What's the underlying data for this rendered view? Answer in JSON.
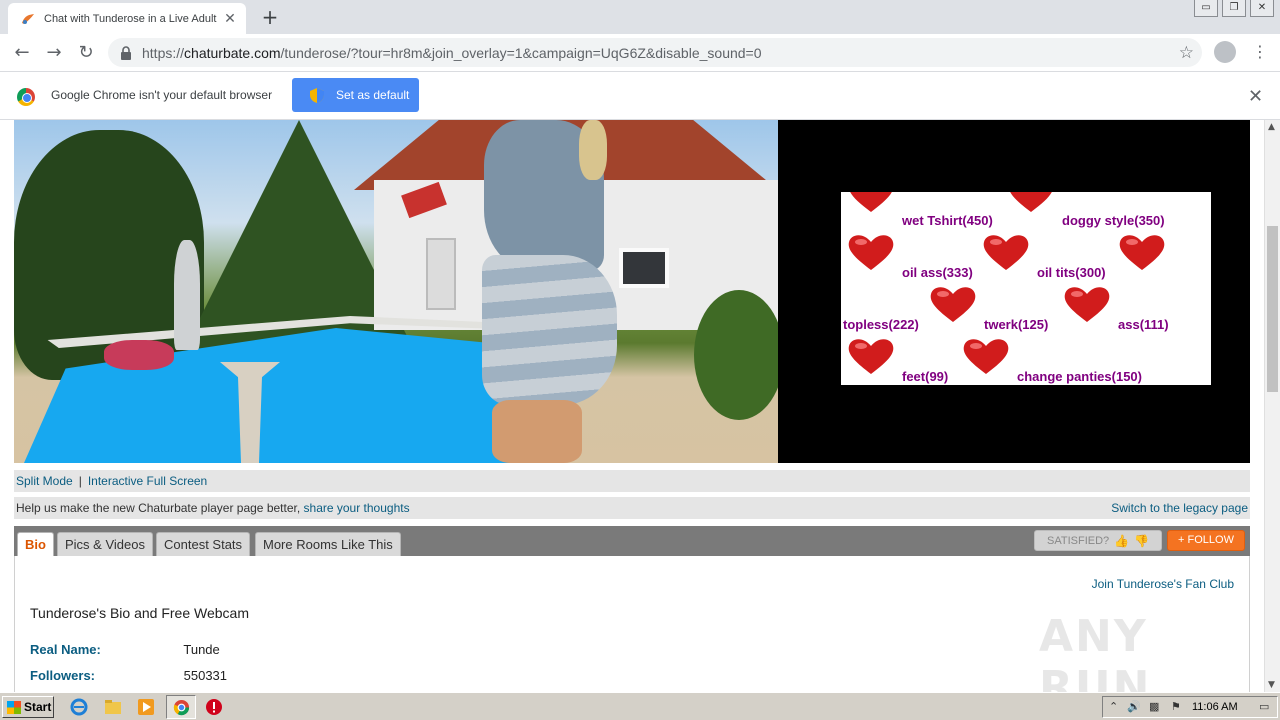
{
  "browser": {
    "tab_title": "Chat with Tunderose in a Live Adult",
    "tab_close": "✕",
    "new_tab": "+",
    "url_scheme": "https://",
    "url_host": "chaturbate.com",
    "url_path": "/tunderose/?tour=hr8m&join_overlay=1&campaign=UqG6Z&disable_sound=0",
    "window_controls": [
      "▭",
      "❐",
      "✕"
    ]
  },
  "infobar": {
    "message": "Google Chrome isn't your default browser",
    "button": "Set as default",
    "close": "✕"
  },
  "tip_menu": [
    {
      "label": "wet Tshirt(450)"
    },
    {
      "label": "doggy style(350)"
    },
    {
      "label": "oil ass(333)"
    },
    {
      "label": "oil tits(300)"
    },
    {
      "label": "topless(222)"
    },
    {
      "label": "twerk(125)"
    },
    {
      "label": "ass(111)"
    },
    {
      "label": "feet(99)"
    },
    {
      "label": "change panties(150)"
    }
  ],
  "player_controls": {
    "split_mode": "Split Mode",
    "separator": "|",
    "fullscreen": "Interactive Full Screen"
  },
  "feedback_bar": {
    "text": "Help us make the new Chaturbate player page better, ",
    "link": "share your thoughts",
    "legacy": "Switch to the legacy page"
  },
  "tabs": [
    {
      "label": "Bio",
      "active": true
    },
    {
      "label": "Pics & Videos",
      "active": false
    },
    {
      "label": "Contest Stats",
      "active": false
    },
    {
      "label": "More Rooms Like This",
      "active": false
    }
  ],
  "satisfied": "SATISFIED?",
  "follow": "+ FOLLOW",
  "bio": {
    "fan_club": "Join Tunderose's Fan Club",
    "title": "Tunderose's Bio and Free Webcam",
    "rows": [
      {
        "key": "Real Name:",
        "value": "Tunde"
      },
      {
        "key": "Followers:",
        "value": "550331"
      }
    ]
  },
  "watermark": "ANY RUN",
  "taskbar": {
    "start": "Start",
    "clock": "11:06 AM"
  },
  "colors": {
    "tip_label": "#800080",
    "link": "#0b5d81",
    "follow_bg": "#f47321",
    "active_tab_text": "#dc5500",
    "set_default_bg": "#4a8af4"
  }
}
